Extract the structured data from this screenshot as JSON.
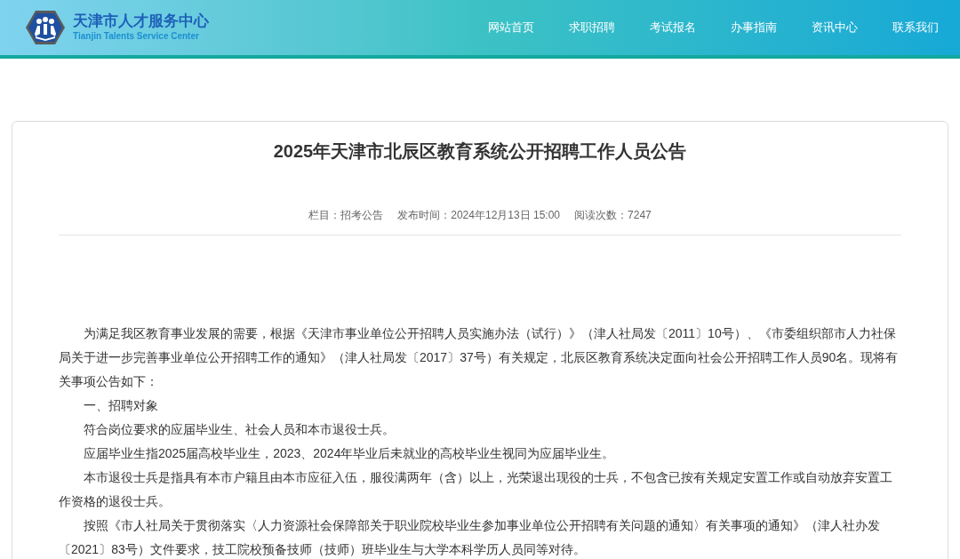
{
  "header": {
    "site_name": "天津市人才服务中心",
    "site_name_en": "Tianjin Talents Service Center"
  },
  "nav": [
    {
      "label": "网站首页"
    },
    {
      "label": "求职招聘"
    },
    {
      "label": "考试报名"
    },
    {
      "label": "办事指南"
    },
    {
      "label": "资讯中心"
    },
    {
      "label": "联系我们"
    }
  ],
  "article": {
    "title": "2025年天津市北辰区教育系统公开招聘工作人员公告",
    "meta": [
      "栏目：招考公告",
      "发布时间：2024年12月13日 15:00",
      "阅读次数：7247"
    ],
    "paragraphs": [
      "为满足我区教育事业发展的需要，根据《天津市事业单位公开招聘人员实施办法（试行）》（津人社局发〔2011〕10号）、《市委组织部市人力社保局关于进一步完善事业单位公开招聘工作的通知》（津人社局发〔2017〕37号）有关规定，北辰区教育系统决定面向社会公开招聘工作人员90名。现将有关事项公告如下：",
      "一、招聘对象",
      "符合岗位要求的应届毕业生、社会人员和本市退役士兵。",
      "应届毕业生指2025届高校毕业生，2023、2024年毕业后未就业的高校毕业生视同为应届毕业生。",
      "本市退役士兵是指具有本市户籍且由本市应征入伍，服役满两年（含）以上，光荣退出现役的士兵，不包含已按有关规定安置工作或自动放弃安置工作资格的退役士兵。",
      "按照《市人社局关于贯彻落实〈人力资源社会保障部关于职业院校毕业生参加事业单位公开招聘有关问题的通知〉有关事项的通知》（津人社办发〔2021〕83号）文件要求，技工院校预备技师（技师）班毕业生与大学本科学历人员同等对待。"
    ]
  }
}
